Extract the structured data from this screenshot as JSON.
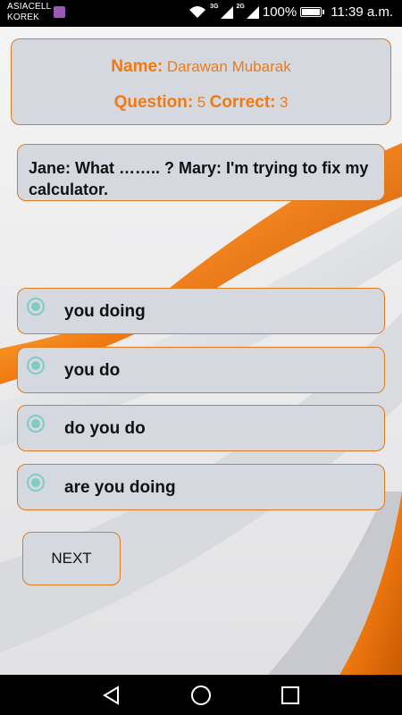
{
  "status_bar": {
    "carrier_line1": "ASIACELL",
    "carrier_line2": "KOREK",
    "net1": "3G",
    "net2": "2G",
    "battery": "100%",
    "time": "11:39 a.m."
  },
  "info": {
    "name_label": "Name:",
    "name_value": "Darawan Mubarak",
    "question_label": "Question:",
    "question_value": "5",
    "correct_label": "Correct:",
    "correct_value": "3"
  },
  "question": {
    "text": "Jane: What  ……..   ? Mary: I'm trying to fix my calculator."
  },
  "options": [
    {
      "label": "you doing"
    },
    {
      "label": "you do"
    },
    {
      "label": "do you do"
    },
    {
      "label": "are you doing"
    }
  ],
  "next_label": "NEXT",
  "colors": {
    "accent": "#f07a12",
    "card": "#d6d8e0",
    "radio": "#80cbc4"
  },
  "icons": [
    "wifi-icon",
    "signal-icon",
    "battery-icon",
    "back-icon",
    "home-icon",
    "recents-icon"
  ]
}
